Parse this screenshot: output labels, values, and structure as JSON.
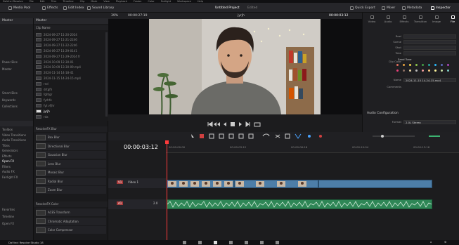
{
  "menu": [
    "DaVinci Resolve",
    "File",
    "Edit",
    "Trim",
    "Timeline",
    "Clip",
    "Mark",
    "View",
    "Playback",
    "Fusion",
    "Color",
    "Fairlight",
    "Workspace",
    "Help"
  ],
  "toolbar": {
    "media_pool": "Media Pool",
    "effects": "Effects",
    "edit_index": "Edit Index",
    "sound_library": "Sound Library",
    "project_title": "Untitled Project",
    "project_status": "Edited",
    "quick_export": "Quick Export",
    "mixer": "Mixer",
    "metadata": "Metadata",
    "inspector": "Inspector"
  },
  "viewer": {
    "zoom": "39%",
    "source_timecode": "00:00:27:19",
    "clip_label": "jyrjh",
    "timecode": "00:00:03:12",
    "clip_name": "2024-11-15 14-24-15.mp4"
  },
  "bins": {
    "master_header": "Master",
    "power_bins_header": "Power Bins",
    "power_master": "Master",
    "smart_bins_header": "Smart Bins",
    "smart_items": [
      "Keywords",
      "Collections"
    ]
  },
  "clips": {
    "master_label": "Master",
    "header": "Clip Name",
    "items": [
      "2024-09-27 11-20-2024",
      "2024-09-27 11-21-2246",
      "2024-09-27 11-22-2246",
      "2024-09-27 11-29-0141",
      "2024-09-27 11-29-2024 fr",
      "2024-10-09 12-30-01",
      "2024-10-09 13-30-09.mp4",
      "2024-11-14 14-18-41",
      "2024-11-15 14-24-15.mp4",
      "rnd",
      "drtgfh",
      "fghtgr",
      "fyrhfe",
      "fyt vfjhr",
      "jyrjh",
      "rda"
    ]
  },
  "inspector": {
    "tabs": [
      "Video",
      "Audio",
      "Effects",
      "Transition",
      "Image",
      "File"
    ],
    "fields": [
      {
        "label": "Reel",
        "value": ""
      },
      {
        "label": "Scene",
        "value": ""
      },
      {
        "label": "Shot",
        "value": ""
      },
      {
        "label": "Take",
        "value": ""
      }
    ],
    "clip_color_label": "Clip Color",
    "clip_color_value": "Sand Tone",
    "name_label": "Name",
    "name_value": "2024-11-15 14-24-15.mp4",
    "comments_label": "Comments",
    "audio_config_label": "Audio Configuration",
    "format_label": "Format",
    "format_value": "2.0L Stereo",
    "colors": [
      "#e06c5b",
      "#e8a23f",
      "#f1d14a",
      "#8bc34a",
      "#43a047",
      "#26a69a",
      "#29b6f6",
      "#5c6bc0",
      "#ab47bc",
      "#ec407a",
      "#8d6e63",
      "#e6d3a3",
      "#bdbdbd",
      "#ef9a9a",
      "#ffcc80",
      "#fff59d",
      "#c5e1a5",
      "#80cbc4"
    ]
  },
  "effects_nav": {
    "items": [
      "Toolbox",
      "Video Transitions",
      "Audio Transitions",
      "Titles",
      "Generators",
      "Effects",
      "Open FX",
      "Filters",
      "Audio FX",
      "Fairlight FX"
    ],
    "selected": "Open FX",
    "favorites_header": "Favorites",
    "favorites": [
      "Timeline",
      "Open FX"
    ]
  },
  "fxlist": {
    "blur_header": "ResolveFX Blur",
    "blur_items": [
      "Box Blur",
      "Directional Blur",
      "Gaussian Blur",
      "Lens Blur",
      "Mosaic Blur",
      "Radial Blur",
      "Zoom Blur"
    ],
    "color_header": "ResolveFX Color",
    "color_items": [
      "ACES Transform",
      "Chromatic Adaptation",
      "Color Compressor"
    ]
  },
  "timeline": {
    "timecode": "00:00:03:12",
    "ruler": [
      "00:00:00:00",
      "00:00:03:12",
      "00:00:06:16",
      "00:00:10:04",
      "00:00:13:16"
    ],
    "video_track": {
      "id": "V1",
      "name": "Video 1"
    },
    "audio_track": {
      "id": "A1",
      "level": "2.0"
    }
  },
  "status": {
    "app": "DaVinci Resolve Studio 18"
  }
}
